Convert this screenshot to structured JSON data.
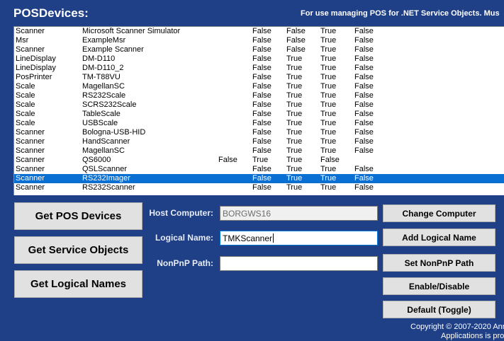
{
  "header": {
    "title": "POSDevices:",
    "subtitle": "For use managing POS for .NET Service Objects. Mus"
  },
  "devices": [
    [
      "Scanner",
      "Microsoft Scanner Simulator",
      "",
      "False",
      "False",
      "True",
      "False"
    ],
    [
      "Msr",
      "ExampleMsr",
      "",
      "False",
      "False",
      "True",
      "False"
    ],
    [
      "Scanner",
      "Example Scanner",
      "",
      "False",
      "False",
      "True",
      "False"
    ],
    [
      "LineDisplay",
      "DM-D110",
      "",
      "False",
      "True",
      "True",
      "False"
    ],
    [
      "LineDisplay",
      "DM-D110_2",
      "",
      "False",
      "True",
      "True",
      "False"
    ],
    [
      "PosPrinter",
      "TM-T88VU",
      "",
      "False",
      "True",
      "True",
      "False"
    ],
    [
      "Scale",
      "MagellanSC",
      "",
      "False",
      "True",
      "True",
      "False"
    ],
    [
      "Scale",
      "RS232Scale",
      "",
      "False",
      "True",
      "True",
      "False"
    ],
    [
      "Scale",
      "SCRS232Scale",
      "",
      "False",
      "True",
      "True",
      "False"
    ],
    [
      "Scale",
      "TableScale",
      "",
      "False",
      "True",
      "True",
      "False"
    ],
    [
      "Scale",
      "USBScale",
      "",
      "False",
      "True",
      "True",
      "False"
    ],
    [
      "Scanner",
      "Bologna-USB-HID",
      "",
      "False",
      "True",
      "True",
      "False"
    ],
    [
      "Scanner",
      "HandScanner",
      "",
      "False",
      "True",
      "True",
      "False"
    ],
    [
      "Scanner",
      "MagellanSC",
      "",
      "False",
      "True",
      "True",
      "False"
    ],
    [
      "Scanner",
      "QS6000",
      "False",
      "True",
      "True",
      "False",
      ""
    ],
    [
      "Scanner",
      "QSLScanner",
      "",
      "False",
      "True",
      "True",
      "False"
    ],
    [
      "Scanner",
      "RS232Imager",
      "",
      "False",
      "True",
      "True",
      "False"
    ],
    [
      "Scanner",
      "RS232Scanner",
      "",
      "False",
      "True",
      "True",
      "False"
    ]
  ],
  "selected_row": 16,
  "buttons": {
    "get_pos_devices": "Get POS Devices",
    "get_service_objects": "Get Service Objects",
    "get_logical_names": "Get Logical Names",
    "change_computer": "Change Computer",
    "add_logical_name": "Add Logical Name",
    "set_nonpnp_path": "Set NonPnP Path",
    "enable_disable": "Enable/Disable",
    "default_toggle": "Default (Toggle)"
  },
  "fields": {
    "host_computer_label": "Host Computer:",
    "host_computer_value": "BORGWS16",
    "logical_name_label": "Logical Name:",
    "logical_name_value": "TMKScanner",
    "nonpnp_path_label": "NonPnP Path:",
    "nonpnp_path_value": ""
  },
  "footer": {
    "copyright_line1": "Copyright © 2007-2020 Anr",
    "copyright_line2": "Applications is pro"
  },
  "colors": {
    "background": "#1f3f86",
    "selection": "#0a6fd3"
  }
}
